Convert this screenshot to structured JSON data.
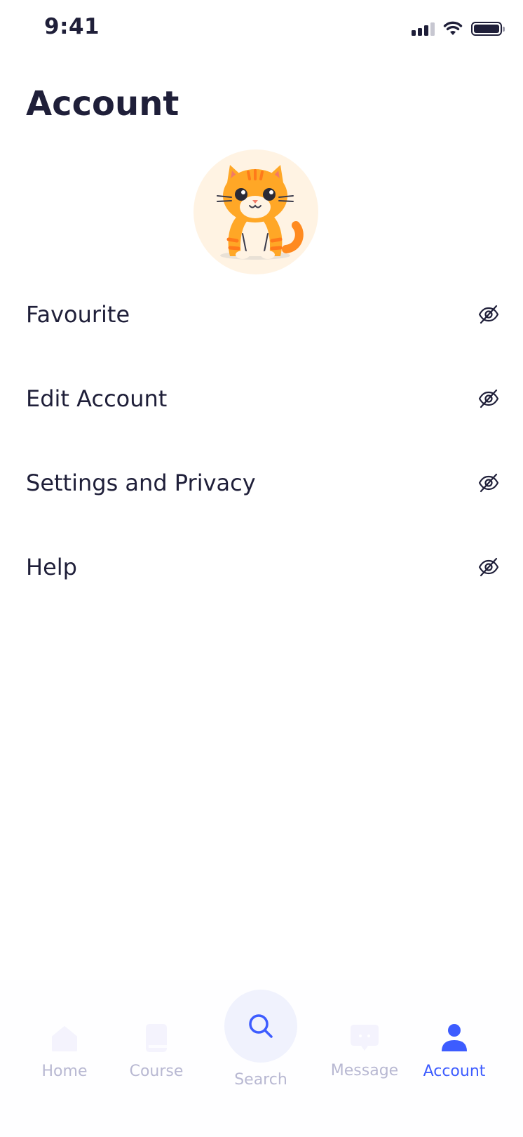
{
  "status_bar": {
    "time": "9:41"
  },
  "header": {
    "title": "Account"
  },
  "menu": {
    "items": [
      {
        "label": "Favourite",
        "icon": "eye-off-icon"
      },
      {
        "label": "Edit Account",
        "icon": "eye-off-icon"
      },
      {
        "label": "Settings and Privacy",
        "icon": "eye-off-icon"
      },
      {
        "label": "Help",
        "icon": "eye-off-icon"
      }
    ]
  },
  "bottom_nav": {
    "items": [
      {
        "label": "Home",
        "icon": "home-icon",
        "active": false
      },
      {
        "label": "Course",
        "icon": "book-icon",
        "active": false
      },
      {
        "label": "Search",
        "icon": "search-icon",
        "active": false
      },
      {
        "label": "Message",
        "icon": "message-icon",
        "active": false
      },
      {
        "label": "Account",
        "icon": "user-icon",
        "active": true
      }
    ]
  },
  "colors": {
    "text_primary": "#1f1f39",
    "accent": "#3d5cff",
    "inactive": "#b8b8d2",
    "avatar_bg": "#fff3e3"
  }
}
